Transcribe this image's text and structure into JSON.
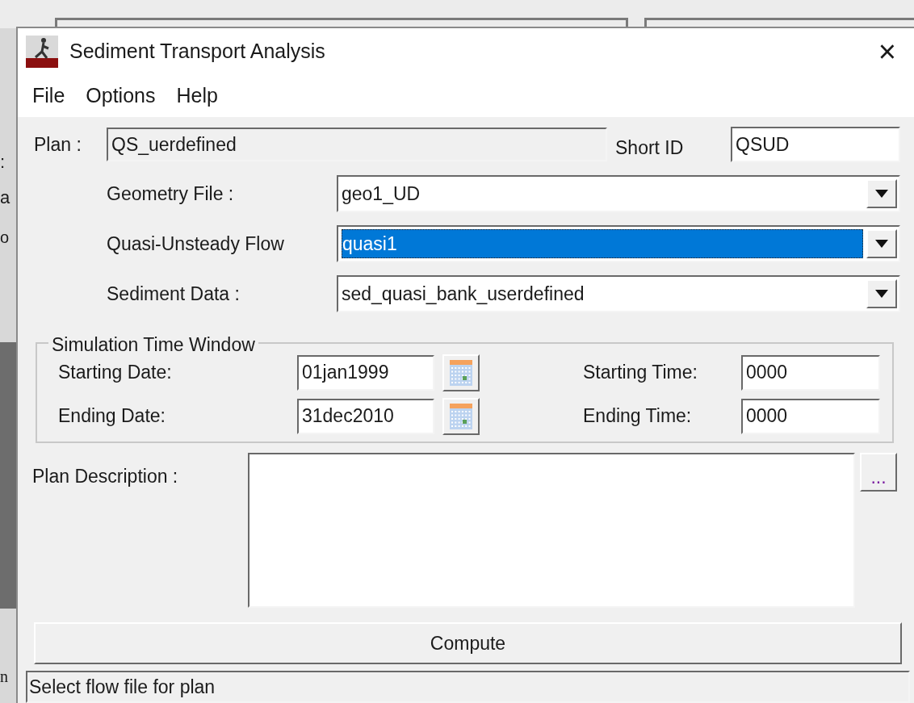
{
  "background_window": {
    "fragments": [
      ":",
      "a",
      "o",
      "n"
    ]
  },
  "window": {
    "title": "Sediment Transport Analysis",
    "close": "×"
  },
  "menu": [
    "File",
    "Options",
    "Help"
  ],
  "plan": {
    "label": "Plan :",
    "value": "QS_uerdefined",
    "short_id_label": "Short ID",
    "short_id": "QSUD"
  },
  "files": [
    {
      "label": "Geometry File :",
      "value": "geo1_UD",
      "selected": false
    },
    {
      "label": "Quasi-Unsteady Flow",
      "value": "quasi1",
      "selected": true
    },
    {
      "label": "Sediment Data :",
      "value": "sed_quasi_bank_userdefined",
      "selected": false
    }
  ],
  "time_window": {
    "title": "Simulation Time Window",
    "rows": [
      {
        "date_label": "Starting Date:",
        "date": "01jan1999",
        "time_label": "Starting Time:",
        "time": "0000"
      },
      {
        "date_label": "Ending Date:",
        "date": "31dec2010",
        "time_label": "Ending Time:",
        "time": "0000"
      }
    ]
  },
  "description": {
    "label": "Plan Description :",
    "button": "..."
  },
  "compute": "Compute",
  "status_bar": "Select flow file for plan"
}
